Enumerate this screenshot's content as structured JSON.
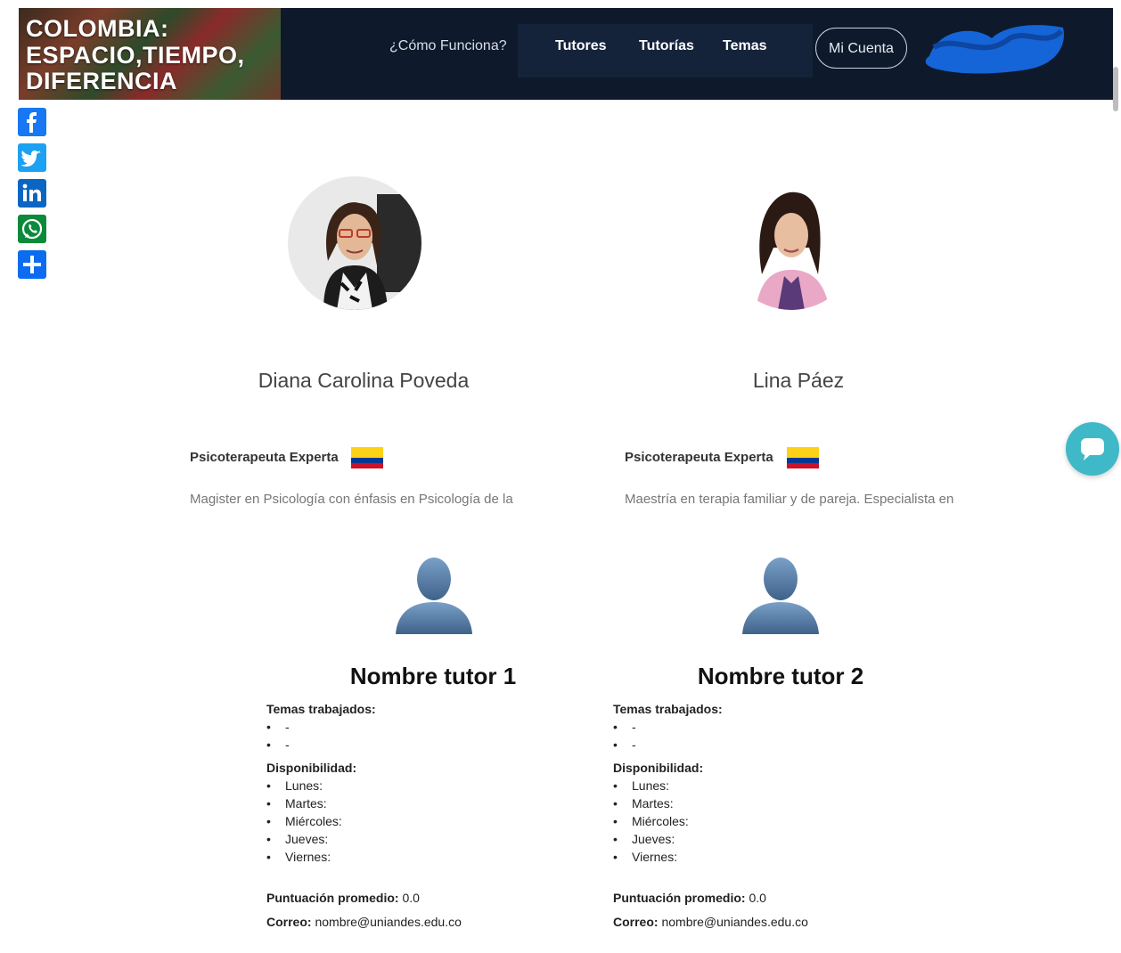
{
  "header": {
    "logo_lines": [
      "COLOMBIA:",
      "ESPACIO,TIEMPO,",
      "DIFERENCIA"
    ],
    "nav": {
      "how_it_works": "¿Cómo Funciona?",
      "tutors": "Tutores",
      "tutorials": "Tutorías",
      "topics": "Temas"
    },
    "account_button": "Mi Cuenta",
    "bg_color": "#0e1a2b",
    "nav_box_color": "#15233a"
  },
  "social": [
    "facebook-icon",
    "twitter-icon",
    "linkedin-icon",
    "whatsapp-icon",
    "share-plus-icon"
  ],
  "profiles": [
    {
      "name": "Diana Carolina Poveda",
      "role": "Psicoterapeuta Experta",
      "description": "Magister en Psicología con énfasis en Psicología de la"
    },
    {
      "name": "Lina Páez",
      "role": "Psicoterapeuta Experta",
      "description": "Maestría en terapia familiar y de pareja. Especialista en"
    }
  ],
  "tutors": [
    {
      "title": "Nombre tutor 1",
      "topics_label": "Temas trabajados:",
      "topics": [
        "-",
        "-"
      ],
      "availability_label": "Disponibilidad:",
      "days": [
        "Lunes:",
        "Martes:",
        "Miércoles:",
        "Jueves:",
        "Viernes:"
      ],
      "rating_label": "Puntuación promedio:",
      "rating_value": "0.0",
      "email_label": "Correo:",
      "email_value": "nombre@uniandes.edu.co"
    },
    {
      "title": "Nombre tutor 2",
      "topics_label": "Temas trabajados:",
      "topics": [
        "-",
        "-"
      ],
      "availability_label": "Disponibilidad:",
      "days": [
        "Lunes:",
        "Martes:",
        "Miércoles:",
        "Jueves:",
        "Viernes:"
      ],
      "rating_label": "Puntuación promedio:",
      "rating_value": "0.0",
      "email_label": "Correo:",
      "email_value": "nombre@uniandes.edu.co"
    }
  ],
  "colors": {
    "social_blue": "#1877f2",
    "chat_teal": "#3fb9c8",
    "flag_yellow": "#fcd116",
    "flag_blue": "#003893",
    "flag_red": "#ce1126"
  }
}
